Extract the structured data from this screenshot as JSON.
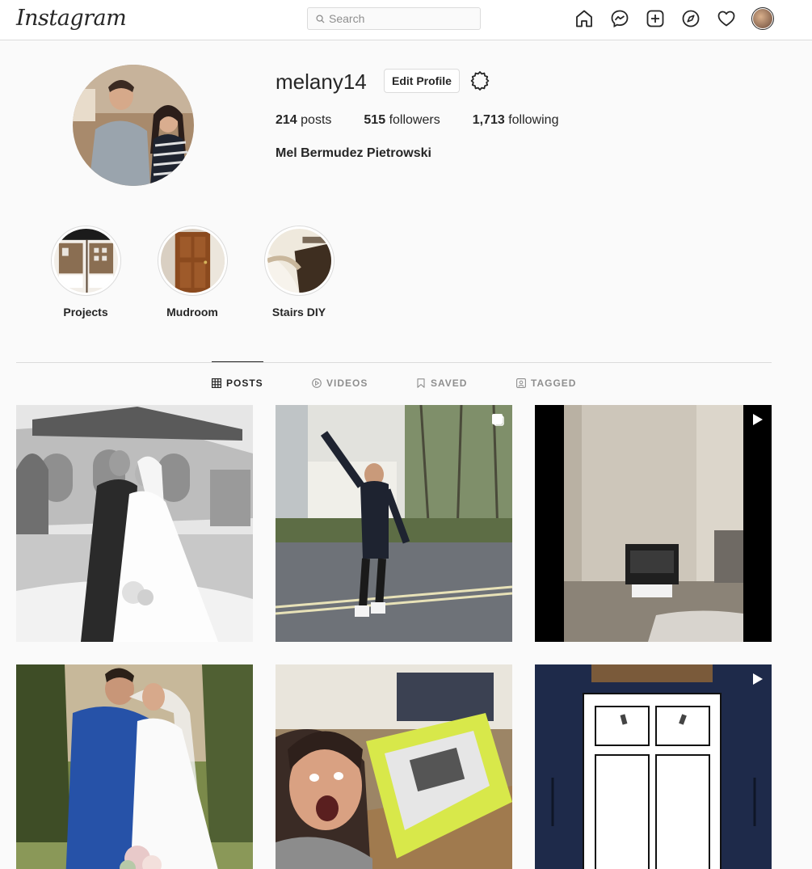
{
  "nav": {
    "logo": "Instagram",
    "search_placeholder": "Search",
    "icons": [
      "home-icon",
      "messenger-icon",
      "new-post-icon",
      "explore-icon",
      "activity-heart-icon"
    ]
  },
  "profile": {
    "username": "melany14",
    "edit_label": "Edit Profile",
    "posts_count": "214",
    "posts_label": "posts",
    "followers_count": "515",
    "followers_label": "followers",
    "following_count": "1,713",
    "following_label": "following",
    "full_name": "Mel Bermudez Pietrowski"
  },
  "highlights": [
    {
      "label": "Projects"
    },
    {
      "label": "Mudroom"
    },
    {
      "label": "Stairs DIY"
    }
  ],
  "tabs": [
    {
      "label": "POSTS",
      "active": true
    },
    {
      "label": "VIDEOS",
      "active": false
    },
    {
      "label": "SAVED",
      "active": false
    },
    {
      "label": "TAGGED",
      "active": false
    }
  ],
  "posts": [
    {
      "type": "photo"
    },
    {
      "type": "carousel"
    },
    {
      "type": "video"
    },
    {
      "type": "photo"
    },
    {
      "type": "photo"
    },
    {
      "type": "video"
    }
  ],
  "colors": {
    "text": "#262626",
    "muted": "#8e8e8e",
    "border": "#dbdbdb",
    "background": "#fafafa"
  }
}
